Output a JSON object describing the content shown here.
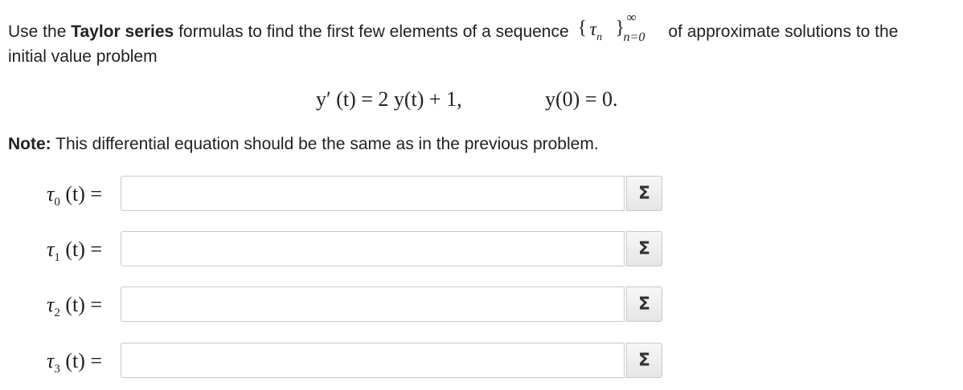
{
  "problem": {
    "intro_before_bold": "Use the ",
    "bold_phrase": "Taylor series",
    "intro_after_bold": " formulas to find the first few elements of a sequence",
    "intro_end": "of approximate solutions to the",
    "line2": "initial value problem",
    "seq_open": "{",
    "seq_tau": "τ",
    "seq_tau_sub": "n",
    "seq_close": "}",
    "seq_upper": "∞",
    "seq_lower": "n=0",
    "equation": "y′ (t) = 2 y(t) + 1,",
    "initial_condition": "y(0) = 0."
  },
  "note": {
    "label": "Note:",
    "text": " This differential equation should be the same as in the previous problem."
  },
  "answers": [
    {
      "tau": "τ",
      "sub": "0",
      "rest": "(t) =",
      "value": "",
      "sigma": "Σ"
    },
    {
      "tau": "τ",
      "sub": "1",
      "rest": "(t) =",
      "value": "",
      "sigma": "Σ"
    },
    {
      "tau": "τ",
      "sub": "2",
      "rest": "(t) =",
      "value": "",
      "sigma": "Σ"
    },
    {
      "tau": "τ",
      "sub": "3",
      "rest": "(t) =",
      "value": "",
      "sigma": "Σ"
    }
  ]
}
